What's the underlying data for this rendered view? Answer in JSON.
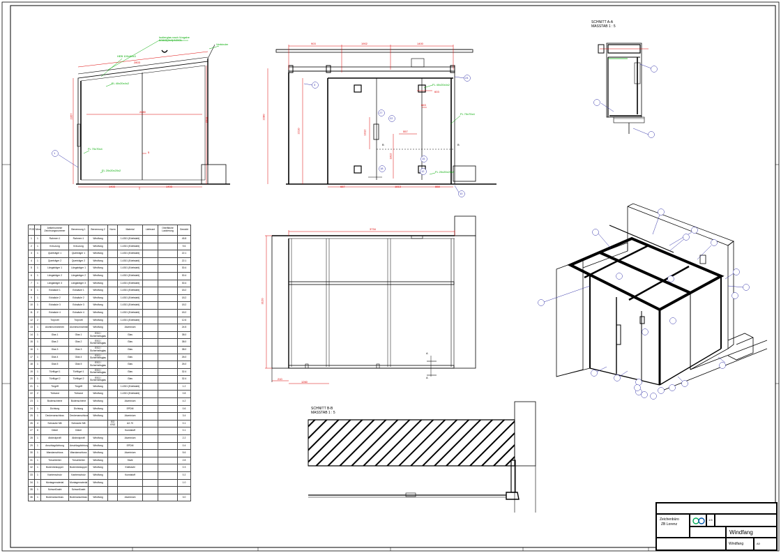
{
  "views": {
    "section_aa": {
      "title": "SCHNITT A-A",
      "scale": "MASSTAB 1 : 5"
    },
    "section_bb": {
      "title": "SCHNITT B-B",
      "scale": "MASSTAB 1 : 5"
    }
  },
  "front_view": {
    "dims": {
      "top": "2803",
      "inner": "2880",
      "left_h": "2357",
      "right_h": "2611",
      "bottom_a": "1403",
      "bottom_b": "1403"
    },
    "callouts": {
      "glass": "Isolierglas nach Vorgabe 8/16/2(2x4)/4/2/GL",
      "profile_top": "HEB 100x60x3",
      "profile_mid": "FL 40x20x4x2",
      "profile_left": "FL 70x70x4",
      "profile_bottom": "FL 20x20x20x2",
      "corner": "Verbinder"
    },
    "markers": {
      "m1": "1",
      "m5": "5"
    }
  },
  "elevation_view": {
    "dims": {
      "top_a": "903",
      "top_b": "1902",
      "top_c": "1400",
      "height": "2280",
      "inner_h": "2210",
      "door_h": "1812",
      "door_w": "557",
      "handle_h": "1012",
      "side_w": "663",
      "bottom_a": "687",
      "bottom_b": "1813",
      "bottom_c": "888",
      "mid": "603"
    },
    "callouts": {
      "frame": "FL 40x20x4x2",
      "right": "FL 70x70x4",
      "bottom": "FL 20x20x20x2"
    },
    "markers": {
      "b1": "B",
      "b2": "B",
      "a1": "A",
      "a2": "A",
      "c1": "3",
      "c2": "24",
      "c3": "27",
      "c4": "22",
      "c5": "18",
      "c6": "15",
      "c7": "12",
      "c8": "10"
    }
  },
  "plan_view": {
    "dims": {
      "width": "3734",
      "depth": "3120",
      "w_small": "210",
      "w_bottom": "1260"
    },
    "markers": {
      "a_top": "A",
      "a_bot": "A"
    }
  },
  "iso_markers": [
    "2",
    "3",
    "4",
    "5",
    "6",
    "7",
    "8",
    "9",
    "10",
    "11",
    "12",
    "13",
    "14",
    "15",
    "16",
    "17",
    "18",
    "19",
    "20",
    "21",
    "22",
    "23",
    "24",
    "25",
    "26",
    "27"
  ],
  "parts_table": {
    "headers": [
      "POS",
      "Menge",
      "Artikelnummer Zeichnungsnummer",
      "Benennung 1",
      "Benennung 2",
      "Norm",
      "Material",
      "Lieferant",
      "Oberfläche Lackierung",
      "Gewicht"
    ],
    "rows": [
      [
        "1",
        "1",
        "Rahmen 1",
        "Rahmen 1",
        "Windfang",
        "",
        "1.4301 (Edelstahl)",
        "",
        "",
        "45.8"
      ],
      [
        "2",
        "1",
        "Kreuzung",
        "Kreuzung",
        "Windfang",
        "",
        "1.4301 (Edelstahl)",
        "",
        "",
        "9.6"
      ],
      [
        "3",
        "1",
        "Querträger 1",
        "Querträger 1",
        "Windfang",
        "",
        "1.4301 (Edelstahl)",
        "",
        "",
        "22.1"
      ],
      [
        "4",
        "1",
        "Querträger 2",
        "Querträger 2",
        "Windfang",
        "",
        "1.4301 (Edelstahl)",
        "",
        "",
        "22.1"
      ],
      [
        "5",
        "1",
        "Längsträger 1",
        "Längsträger 1",
        "Windfang",
        "",
        "1.4301 (Edelstahl)",
        "",
        "",
        "30.4"
      ],
      [
        "6",
        "1",
        "Längsträger 2",
        "Längsträger 2",
        "Windfang",
        "",
        "1.4301 (Edelstahl)",
        "",
        "",
        "30.4"
      ],
      [
        "7",
        "1",
        "Längsträger 3",
        "Längsträger 3",
        "Windfang",
        "",
        "1.4301 (Edelstahl)",
        "",
        "",
        "30.4"
      ],
      [
        "8",
        "1",
        "Ecksäule 1",
        "Ecksäule 1",
        "Windfang",
        "",
        "1.4301 (Edelstahl)",
        "",
        "",
        "18.2"
      ],
      [
        "9",
        "1",
        "Ecksäule 2",
        "Ecksäule 2",
        "Windfang",
        "",
        "1.4301 (Edelstahl)",
        "",
        "",
        "18.2"
      ],
      [
        "10",
        "1",
        "Ecksäule 3",
        "Ecksäule 3",
        "Windfang",
        "",
        "1.4301 (Edelstahl)",
        "",
        "",
        "18.2"
      ],
      [
        "11",
        "2",
        "Ecksäule 4",
        "Ecksäule 4",
        "Windfang",
        "",
        "1.4301 (Edelstahl)",
        "",
        "",
        "18.2"
      ],
      [
        "12",
        "2",
        "Türprofil",
        "Türprofil",
        "Windfang",
        "",
        "1.4301 (Edelstahl)",
        "",
        "",
        "12.6"
      ],
      [
        "13",
        "1",
        "Aluminiumrahmen",
        "Aluminiumrahmen",
        "Windfang",
        "",
        "Aluminium",
        "",
        "",
        "24.5"
      ],
      [
        "14",
        "1",
        "Glas 1",
        "Glas 1",
        "ESG / Sicherheitsglas",
        "",
        "Glas",
        "",
        "",
        "38.0"
      ],
      [
        "15",
        "1",
        "Glas 2",
        "Glas 2",
        "ESG / Sicherheitsglas",
        "",
        "Glas",
        "",
        "",
        "38.0"
      ],
      [
        "16",
        "1",
        "Glas 3",
        "Glas 3",
        "ESG / Sicherheitsglas",
        "",
        "Glas",
        "",
        "",
        "38.0"
      ],
      [
        "17",
        "1",
        "Glas 4",
        "Glas 4",
        "ESG / Sicherheitsglas",
        "",
        "Glas",
        "",
        "",
        "26.0"
      ],
      [
        "18",
        "1",
        "Glas 5",
        "Glas 5",
        "ESG / Sicherheitsglas",
        "",
        "Glas",
        "",
        "",
        "26.0"
      ],
      [
        "19",
        "1",
        "Türflügel 1",
        "Türflügel 1",
        "ESG / Sicherheitsglas",
        "",
        "Glas",
        "",
        "",
        "32.4"
      ],
      [
        "20",
        "1",
        "Türflügel 2",
        "Türflügel 2",
        "ESG / Sicherheitsglas",
        "",
        "Glas",
        "",
        "",
        "32.4"
      ],
      [
        "21",
        "1",
        "Türgriff",
        "Türgriff",
        "Windfang",
        "",
        "1.4301 (Edelstahl)",
        "",
        "",
        "1.2"
      ],
      [
        "22",
        "2",
        "Türband",
        "Türband",
        "Windfang",
        "",
        "1.4301 (Edelstahl)",
        "",
        "",
        "0.8"
      ],
      [
        "23",
        "1",
        "Bodenschiene",
        "Bodenschiene",
        "Windfang",
        "",
        "Aluminium",
        "",
        "",
        "4.2"
      ],
      [
        "24",
        "1",
        "Dichtung",
        "Dichtung",
        "Windfang",
        "",
        "EPDM",
        "",
        "",
        "0.6"
      ],
      [
        "25",
        "1",
        "Deckenanschluss",
        "Deckenanschluss",
        "Windfang",
        "",
        "Aluminium",
        "",
        "",
        "3.4"
      ],
      [
        "26",
        "4",
        "Schraube M6",
        "Schraube M6",
        "",
        "ISO 4762",
        "A2-70",
        "",
        "",
        "0.1"
      ],
      [
        "27",
        "8",
        "Dübel",
        "Dübel",
        "",
        "",
        "Kunststoff",
        "",
        "",
        "0.1"
      ],
      [
        "28",
        "1",
        "Abdeckprofil",
        "Abdeckprofil",
        "Windfang",
        "",
        "Aluminium",
        "",
        "",
        "2.2"
      ],
      [
        "29",
        "1",
        "Anschlagdichtung",
        "Anschlagdichtung",
        "Windfang",
        "",
        "EPDM",
        "",
        "",
        "0.4"
      ],
      [
        "30",
        "1",
        "Wandanschluss",
        "Wandanschluss",
        "Windfang",
        "",
        "Aluminium",
        "",
        "",
        "5.6"
      ],
      [
        "31",
        "1",
        "Türschließer",
        "Türschließer",
        "Windfang",
        "",
        "Stahl",
        "",
        "",
        "2.8"
      ],
      [
        "32",
        "1",
        "Bodentürstopper",
        "Bodentürstopper",
        "Windfang",
        "",
        "Edelstahl",
        "",
        "",
        "0.3"
      ],
      [
        "33",
        "1",
        "Kantenschutz",
        "Kantenschutz",
        "Windfang",
        "",
        "Kunststoff",
        "",
        "",
        "0.2"
      ],
      [
        "34",
        "1",
        "Montagematerial",
        "Montagematerial",
        "Windfang",
        "",
        "",
        "",
        "",
        "1.0"
      ],
      [
        "35",
        "1",
        "Schweißnaht",
        "Schweißnaht",
        "",
        "",
        "",
        "",
        "",
        ""
      ],
      [
        "36",
        "1",
        "Bodenanschluss",
        "Bodenanschluss",
        "Windfang",
        "",
        "Aluminium",
        "",
        "",
        "3.0"
      ]
    ]
  },
  "title_block": {
    "company": "Zeichenbüro",
    "company2": "ZB Lorenz",
    "title": "Windfang",
    "subtitle": "Windfang",
    "scale": "1:5",
    "sheet": "A0"
  }
}
